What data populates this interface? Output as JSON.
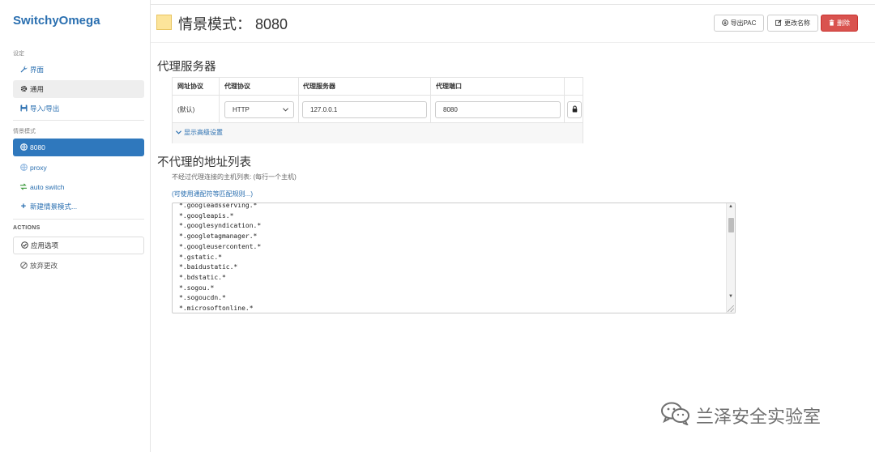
{
  "app": {
    "brand": "SwitchyOmega"
  },
  "sidebar": {
    "settings_label": "设定",
    "settings_items": [
      {
        "label": "界面",
        "icon": "wrench-icon"
      },
      {
        "label": "通用",
        "icon": "gear-icon"
      },
      {
        "label": "导入/导出",
        "icon": "floppy-icon"
      }
    ],
    "profiles_label": "情景模式",
    "profiles": [
      {
        "label": "8080",
        "icon": "globe-icon"
      },
      {
        "label": "proxy",
        "icon": "globe-icon"
      },
      {
        "label": "auto switch",
        "icon": "switch-icon"
      },
      {
        "label": "新建情景模式...",
        "icon": "plus-icon"
      }
    ],
    "actions_label": "ACTIONS",
    "actions": [
      {
        "label": "应用选项",
        "icon": "check-circle-icon"
      },
      {
        "label": "放弃更改",
        "icon": "ban-icon"
      }
    ]
  },
  "header": {
    "title": "情景模式： 8080",
    "swatch_color": "#fce49a",
    "buttons": {
      "export_pac": "导出PAC",
      "rename": "更改名称",
      "delete": "删除"
    }
  },
  "proxy": {
    "heading": "代理服务器",
    "columns": [
      "网址协议",
      "代理协议",
      "代理服务器",
      "代理端口"
    ],
    "row": {
      "scheme": "(默认)",
      "protocol": "HTTP",
      "server": "127.0.0.1",
      "port": "8080"
    },
    "advanced_link": "显示高级设置"
  },
  "bypass": {
    "heading": "不代理的地址列表",
    "hint": "不经过代理连接的主机列表: (每行一个主机)",
    "wildcard_link": "(可使用通配符等匹配规则...)",
    "entries": [
      "*.googleadsserving.*",
      "*.googleapis.*",
      "*.googlesyndication.*",
      "*.googletagmanager.*",
      "*.googleusercontent.*",
      "*.gstatic.*",
      "*.baidustatic.*",
      "*.bdstatic.*",
      "*.sogou.*",
      "*.sogoucdn.*",
      "*.microsoftonline.*"
    ]
  },
  "watermark": {
    "text": "兰泽安全实验室",
    "icon": "wechat-icon"
  },
  "colors": {
    "accent": "#2f78bd",
    "link": "#2a6fb0",
    "danger": "#d9534f"
  }
}
